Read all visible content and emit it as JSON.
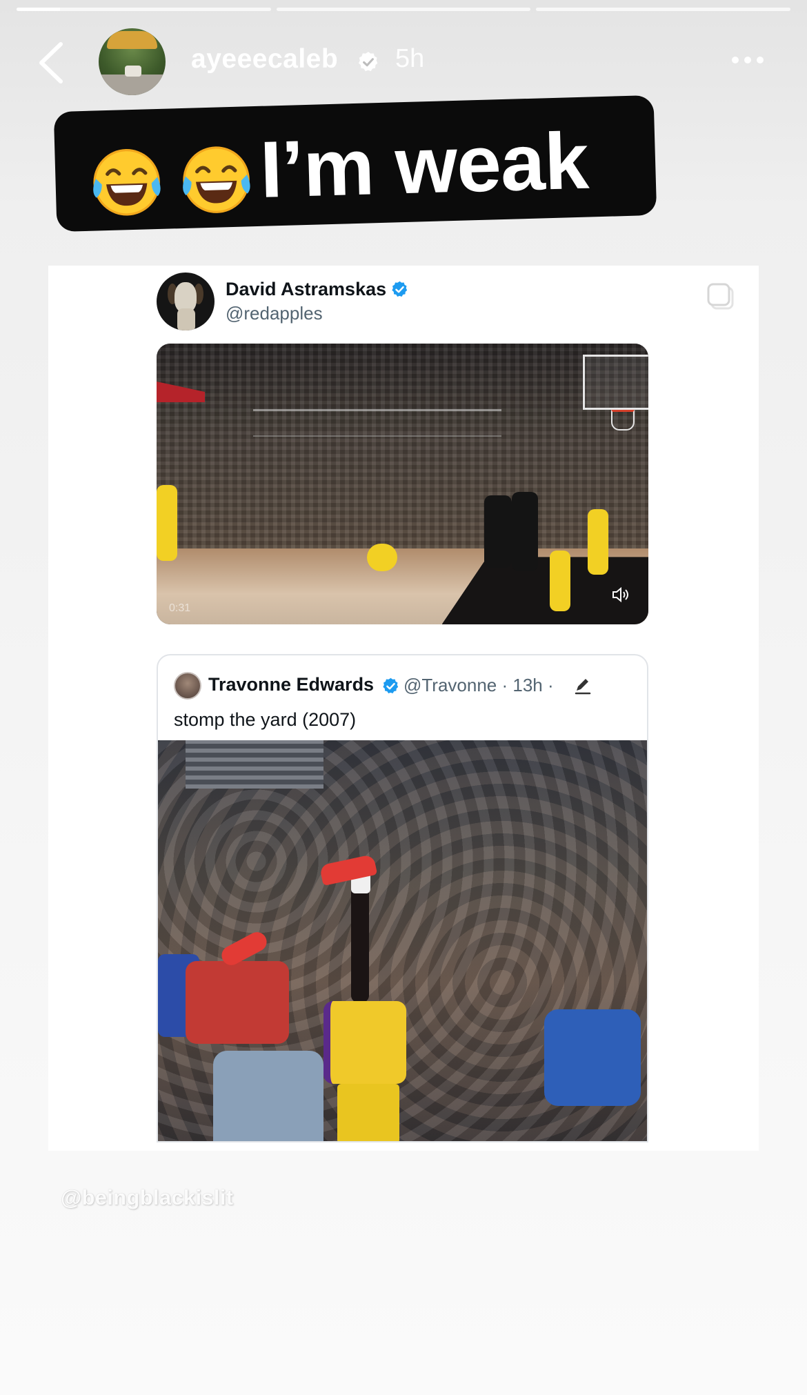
{
  "story": {
    "segments": [
      {
        "progress": 0.17
      },
      {
        "progress": 0
      },
      {
        "progress": 0
      }
    ],
    "username": "ayeeecaleb",
    "time_ago": "5h",
    "caption_text": "I’m weak",
    "caption_emoji": "face-with-tears-of-joy",
    "watermark": "@beingblackislit"
  },
  "tweet": {
    "name": "David Astramskas",
    "handle": "@redapples",
    "video_time": "0:31"
  },
  "quoted_tweet": {
    "name": "Travonne Edwards",
    "handle_meta": "@Travonne · 13h ·",
    "text": "stomp the yard (2007)"
  },
  "colors": {
    "twitter_blue": "#1d9bf0",
    "caption_bg": "#0b0b0b",
    "lakers_gold": "#f2d024"
  }
}
